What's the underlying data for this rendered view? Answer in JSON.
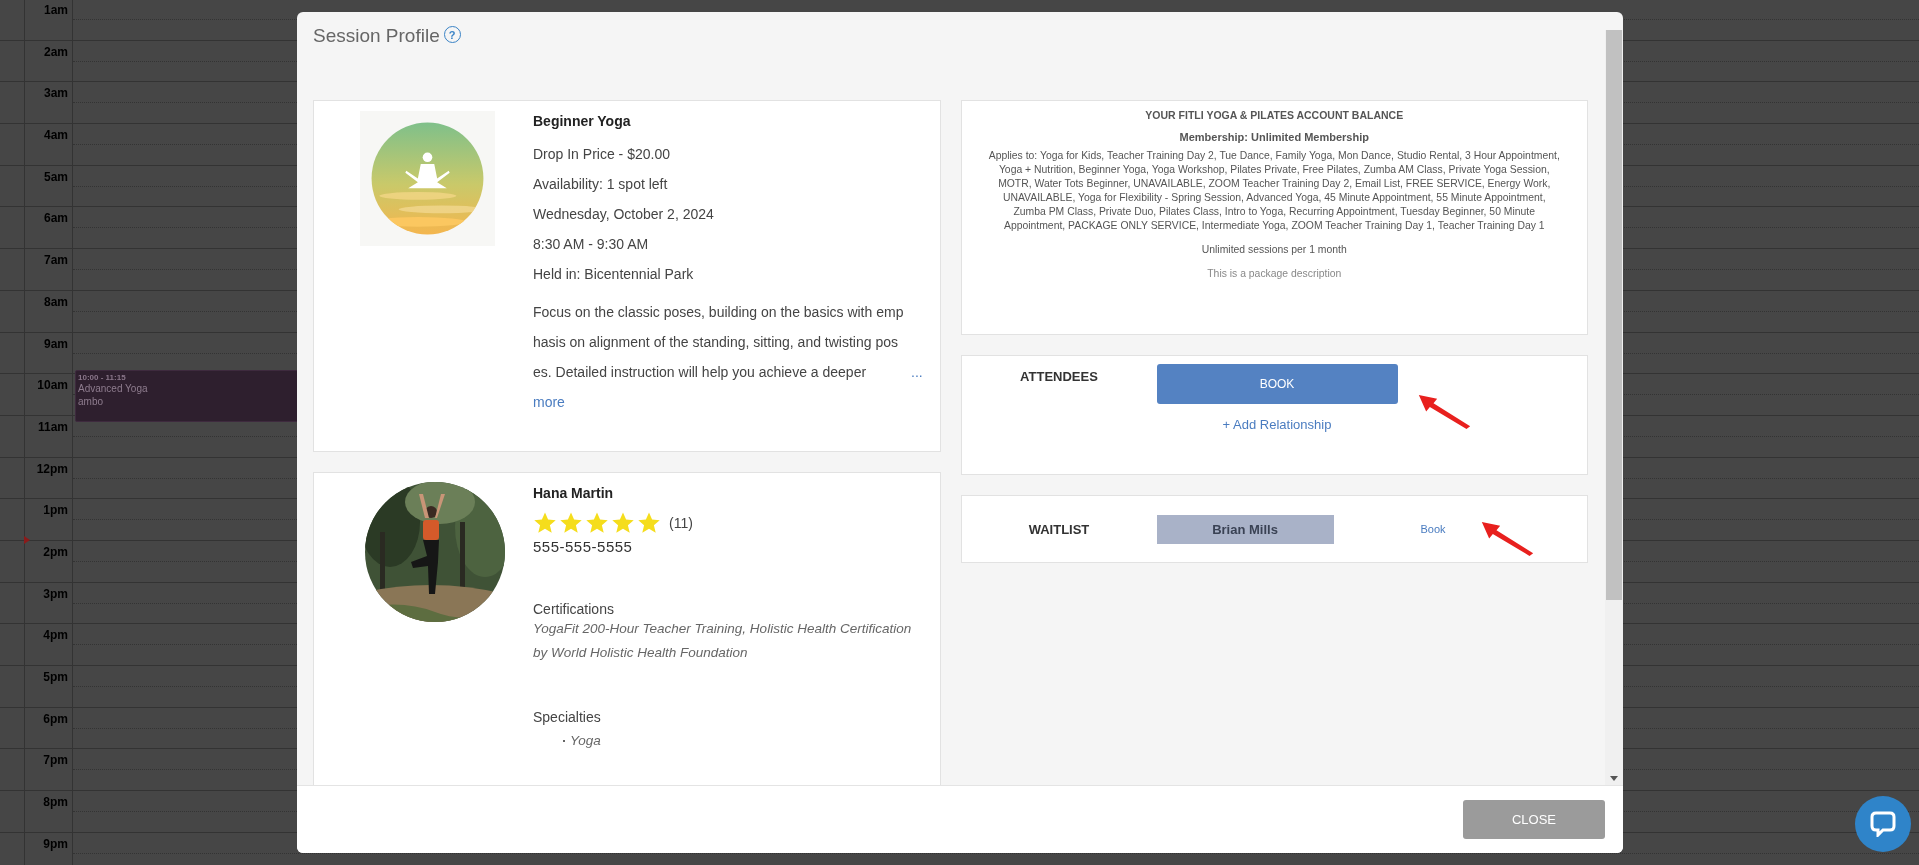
{
  "calendar": {
    "hours": [
      "1am",
      "2am",
      "3am",
      "4am",
      "5am",
      "6am",
      "7am",
      "8am",
      "9am",
      "10am",
      "11am",
      "12pm",
      "1pm",
      "2pm",
      "3pm",
      "4pm",
      "5pm",
      "6pm",
      "7pm",
      "8pm",
      "9pm"
    ],
    "event": {
      "time": "10:00 - 11:15",
      "title": "Advanced Yoga",
      "subtitle": "ambo"
    }
  },
  "modal": {
    "title": "Session Profile",
    "help": "?",
    "session": {
      "title": "Beginner Yoga",
      "lines": [
        "Drop In Price - $20.00",
        "Availability: 1 spot left",
        "Wednesday, October 2, 2024",
        "8:30 AM - 9:30 AM",
        "Held in: Bicentennial Park"
      ],
      "description": "Focus on the classic poses, building on the basics with emphasis on alignment of the standing, sitting, and twisting poses. Detailed instruction will help you achieve a deeper",
      "ellipsis": "...",
      "more": "more"
    },
    "instructor": {
      "name": "Hana Martin",
      "stars": 5,
      "review_count": "(11)",
      "phone": "555-555-5555",
      "certifications_label": "Certifications",
      "certifications": "YogaFit 200-Hour Teacher Training, Holistic Health Certification by World Holistic Health Foundation",
      "specialties_label": "Specialties",
      "specialties": [
        "Yoga"
      ]
    },
    "balance": {
      "heading": "YOUR FITLI YOGA & PILATES ACCOUNT BALANCE",
      "membership": "Membership: Unlimited Membership",
      "applies": "Applies to: Yoga for Kids, Teacher Training Day 2, Tue Dance, Family Yoga, Mon Dance, Studio Rental, 3 Hour Appointment, Yoga + Nutrition, Beginner Yoga, Yoga Workshop, Pilates Private, Free Pilates, Zumba AM Class, Private Yoga Session, MOTR, Water Tots Beginner, UNAVAILABLE, ZOOM Teacher Training Day 2, Email List, FREE SERVICE, Energy Work, UNAVAILABLE, Yoga for Flexibility - Spring Session, Advanced Yoga, 45 Minute Appointment, 55 Minute Appointment, Zumba PM Class, Private Duo, Pilates Class, Intro to Yoga, Recurring Appointment, Tuesday Beginner, 50 Minute Appointment, PACKAGE ONLY SERVICE, Intermediate Yoga, ZOOM Teacher Training Day 1, Teacher Training Day 1",
      "sessions": "Unlimited sessions per 1 month",
      "description": "This is a package description"
    },
    "attendees": {
      "label": "ATTENDEES",
      "button": "BOOK",
      "link": "+ Add Relationship"
    },
    "waitlist": {
      "label": "WAITLIST",
      "person": "Brian Mills",
      "link": "Book"
    },
    "close": "CLOSE"
  }
}
